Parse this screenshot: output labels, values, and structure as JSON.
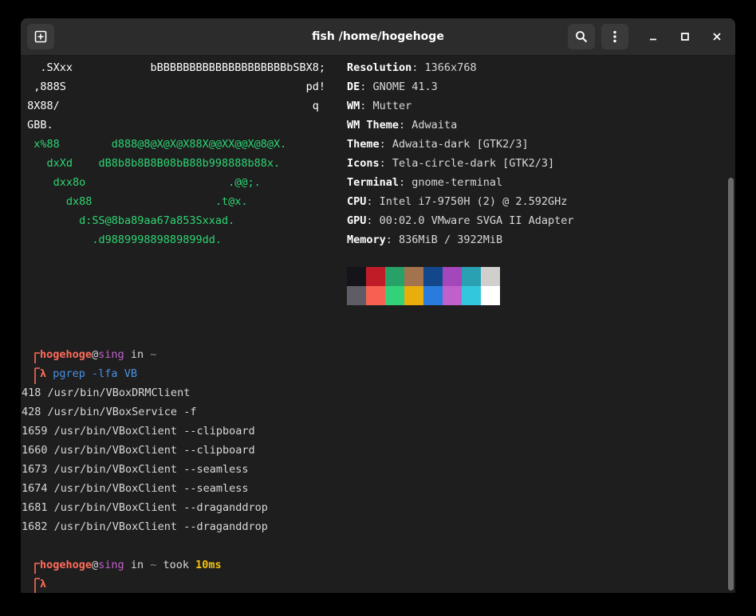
{
  "window": {
    "title": "fish /home/hogehoge"
  },
  "colors": {
    "accent_green": "#2ed573",
    "prompt_red": "#ff6b5b",
    "host_purple": "#c061cb",
    "command_blue": "#4a90e2",
    "duration_gold": "#f5c211"
  },
  "logo": [
    {
      "text": "   .SXxx            bBBBBBBBBBBBBBBBBBBBBbSBX8;",
      "color": "w"
    },
    {
      "text": "  ,888S                                     pd!",
      "color": "w"
    },
    {
      "text": " 8X88/                                       q",
      "color": "w"
    },
    {
      "text": " GBB.",
      "color": "w"
    },
    {
      "text": "  x%88        d888@8@X@X@X88X@@XX@@X@8@X.",
      "color": "g"
    },
    {
      "text": "    dxXd    dB8b8b8B8B08bB88b998888b88x.",
      "color": "g"
    },
    {
      "text": "     dxx8o                      .@@;.",
      "color": "g"
    },
    {
      "text": "       dx88                   .t@x.",
      "color": "g"
    },
    {
      "text": "         d:SS@8ba89aa67a853Sxxad.",
      "color": "g"
    },
    {
      "text": "           .d988999889889899dd.",
      "color": "g"
    }
  ],
  "sysinfo": [
    {
      "key": "Resolution",
      "value": "1366x768"
    },
    {
      "key": "DE",
      "value": "GNOME 41.3"
    },
    {
      "key": "WM",
      "value": "Mutter"
    },
    {
      "key": "WM Theme",
      "value": "Adwaita"
    },
    {
      "key": "Theme",
      "value": "Adwaita-dark [GTK2/3]"
    },
    {
      "key": "Icons",
      "value": "Tela-circle-dark [GTK2/3]"
    },
    {
      "key": "Terminal",
      "value": "gnome-terminal"
    },
    {
      "key": "CPU",
      "value": "Intel i7-9750H (2) @ 2.592GHz"
    },
    {
      "key": "GPU",
      "value": "00:02.0 VMware SVGA II Adapter"
    },
    {
      "key": "Memory",
      "value": "836MiB / 3922MiB"
    }
  ],
  "palette": {
    "normal": [
      "#15141b",
      "#c01c28",
      "#26a269",
      "#a2734c",
      "#12488b",
      "#a347ba",
      "#2aa1b3",
      "#d0cfcc"
    ],
    "bright": [
      "#5e5c64",
      "#f66151",
      "#33d17a",
      "#e9ad0c",
      "#2a7bde",
      "#c061cb",
      "#33c7de",
      "#ffffff"
    ]
  },
  "prompt1": {
    "user": "hogehoge",
    "at": "@",
    "host": "sing",
    "in": " in ",
    "dir": "~",
    "lambda": "λ",
    "command": "pgrep",
    "args": " -lfa VB"
  },
  "output": [
    "418 /usr/bin/VBoxDRMClient",
    "428 /usr/bin/VBoxService -f",
    "1659 /usr/bin/VBoxClient --clipboard",
    "1660 /usr/bin/VBoxClient --clipboard",
    "1673 /usr/bin/VBoxClient --seamless",
    "1674 /usr/bin/VBoxClient --seamless",
    "1681 /usr/bin/VBoxClient --draganddrop",
    "1682 /usr/bin/VBoxClient --draganddrop"
  ],
  "prompt2": {
    "user": "hogehoge",
    "at": "@",
    "host": "sing",
    "in": " in ",
    "dir": "~",
    "took": " took ",
    "duration": "10ms",
    "lambda": "λ"
  }
}
